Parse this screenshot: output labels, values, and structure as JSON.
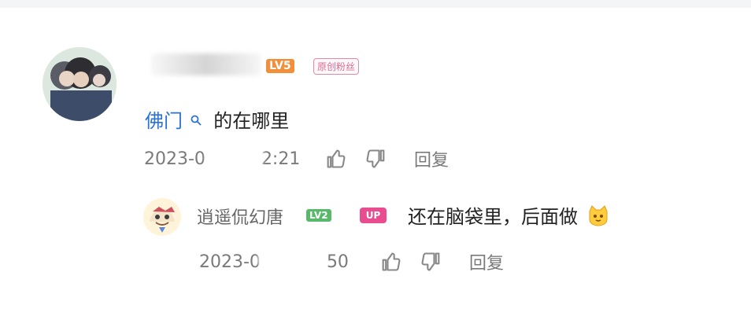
{
  "comment": {
    "badges": {
      "level": "LV5",
      "fan_badge": "原创粉丝"
    },
    "text": {
      "link": "佛门",
      "rest": "的在哪里"
    },
    "meta": {
      "time_start": "2023-0",
      "time_end": "2:21",
      "reply_label": "回复"
    }
  },
  "reply": {
    "user": "逍遥侃幻唐",
    "badges": {
      "level": "LV2",
      "up": "UP"
    },
    "text": "还在脑袋里，后面做",
    "meta": {
      "time_start": "2023-0",
      "time_end": "50",
      "reply_label": "回复"
    }
  },
  "icons": {
    "search": "search-icon",
    "like": "thumb-up-icon",
    "dislike": "thumb-down-icon",
    "emoji": "cat-emoji-icon"
  }
}
